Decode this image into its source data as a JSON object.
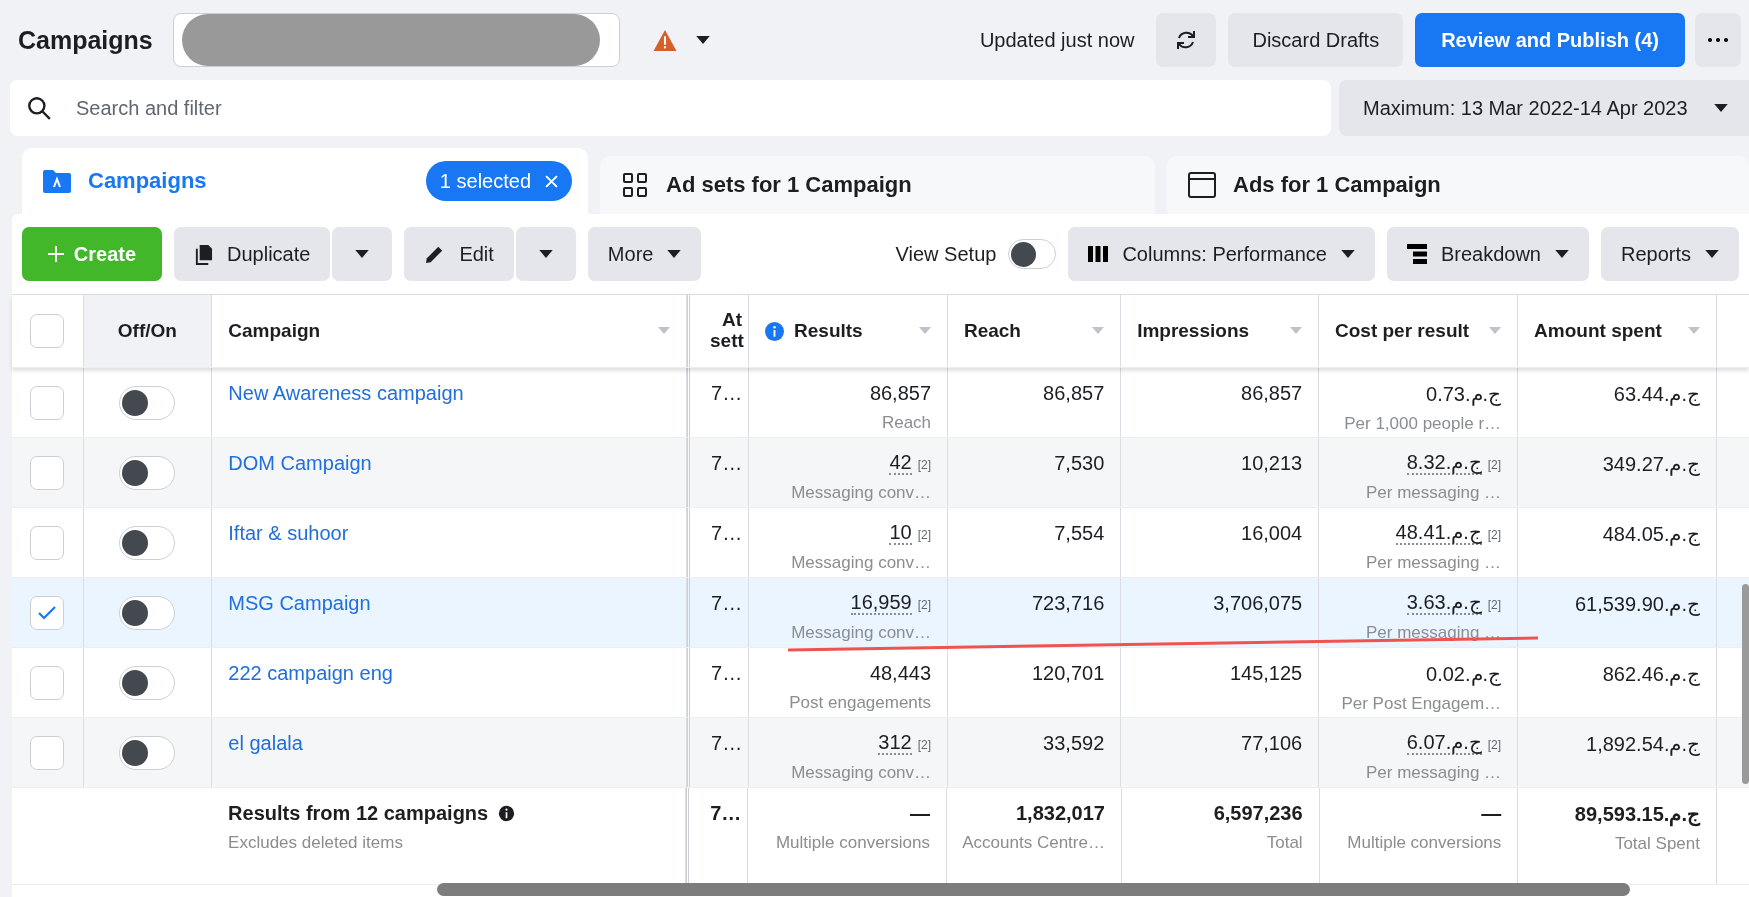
{
  "header": {
    "title": "Campaigns",
    "updated": "Updated just now",
    "discard": "Discard Drafts",
    "publish": "Review and Publish (4)"
  },
  "search": {
    "placeholder": "Search and filter",
    "date_range": "Maximum: 13 Mar 2022-14 Apr 2023"
  },
  "tabs": [
    {
      "kind": "campaigns",
      "label": "Campaigns",
      "selected": true,
      "badge": "1 selected"
    },
    {
      "kind": "adsets",
      "label": "Ad sets for 1 Campaign",
      "selected": false
    },
    {
      "kind": "ads",
      "label": "Ads for 1 Campaign",
      "selected": false
    }
  ],
  "toolbar": {
    "create": "Create",
    "duplicate": "Duplicate",
    "edit": "Edit",
    "more": "More",
    "view_setup": {
      "label": "View Setup",
      "on": false
    },
    "columns": "Columns: Performance",
    "breakdown": "Breakdown",
    "reports": "Reports"
  },
  "table": {
    "select_all": {
      "checked": false
    },
    "columns": [
      "Off/On",
      "Campaign",
      "At sett",
      "Results",
      "Reach",
      "Impressions",
      "Cost per result",
      "Amount spent"
    ],
    "rows": [
      {
        "name": "New Awareness campaign",
        "selected": false,
        "on": false,
        "attribution": "7…",
        "results": {
          "value": "86,857",
          "note": "Reach"
        },
        "reach": "86,857",
        "impressions": "86,857",
        "cost": {
          "value": "ج.م.0.73",
          "note": "Per 1,000 people r…"
        },
        "amount": "ج.م.63.44"
      },
      {
        "name": "DOM Campaign",
        "selected": false,
        "on": false,
        "attribution": "7…",
        "results": {
          "value": "42",
          "footnote": "[2]",
          "note": "Messaging conv…"
        },
        "reach": "7,530",
        "impressions": "10,213",
        "cost": {
          "value": "ج.م.8.32",
          "footnote": "[2]",
          "note": "Per messaging …"
        },
        "amount": "ج.م.349.27"
      },
      {
        "name": "Iftar & suhoor",
        "selected": false,
        "on": false,
        "attribution": "7…",
        "results": {
          "value": "10",
          "footnote": "[2]",
          "note": "Messaging conv…"
        },
        "reach": "7,554",
        "impressions": "16,004",
        "cost": {
          "value": "ج.م.48.41",
          "footnote": "[2]",
          "note": "Per messaging …"
        },
        "amount": "ج.م.484.05"
      },
      {
        "name": "MSG Campaign",
        "selected": true,
        "on": false,
        "attribution": "7…",
        "results": {
          "value": "16,959",
          "footnote": "[2]",
          "note": "Messaging conv…"
        },
        "reach": "723,716",
        "impressions": "3,706,075",
        "cost": {
          "value": "ج.م.3.63",
          "footnote": "[2]",
          "note": "Per messaging …"
        },
        "amount": "ج.م.61,539.90"
      },
      {
        "name": "222 campaign eng",
        "selected": false,
        "on": false,
        "attribution": "7…",
        "results": {
          "value": "48,443",
          "note": "Post engagements"
        },
        "reach": "120,701",
        "impressions": "145,125",
        "cost": {
          "value": "ج.م.0.02",
          "note": "Per Post Engagem…"
        },
        "amount": "ج.م.862.46"
      },
      {
        "name": "el galala",
        "selected": false,
        "on": false,
        "attribution": "7…",
        "results": {
          "value": "312",
          "footnote": "[2]",
          "note": "Messaging conv…"
        },
        "reach": "33,592",
        "impressions": "77,106",
        "cost": {
          "value": "ج.م.6.07",
          "footnote": "[2]",
          "note": "Per messaging …"
        },
        "amount": "ج.م.1,892.54"
      }
    ],
    "totals": {
      "title": "Results from 12 campaigns",
      "subtitle": "Excludes deleted items",
      "attribution": "7…",
      "results": {
        "value": "—",
        "note": "Multiple conversions"
      },
      "reach": {
        "value": "1,832,017",
        "note": "Accounts Centre…"
      },
      "impressions": {
        "value": "6,597,236",
        "note": "Total"
      },
      "cost": {
        "value": "—",
        "note": "Multiple conversions"
      },
      "amount": {
        "value": "ج.م.89,593.15",
        "note": "Total Spent"
      }
    }
  }
}
